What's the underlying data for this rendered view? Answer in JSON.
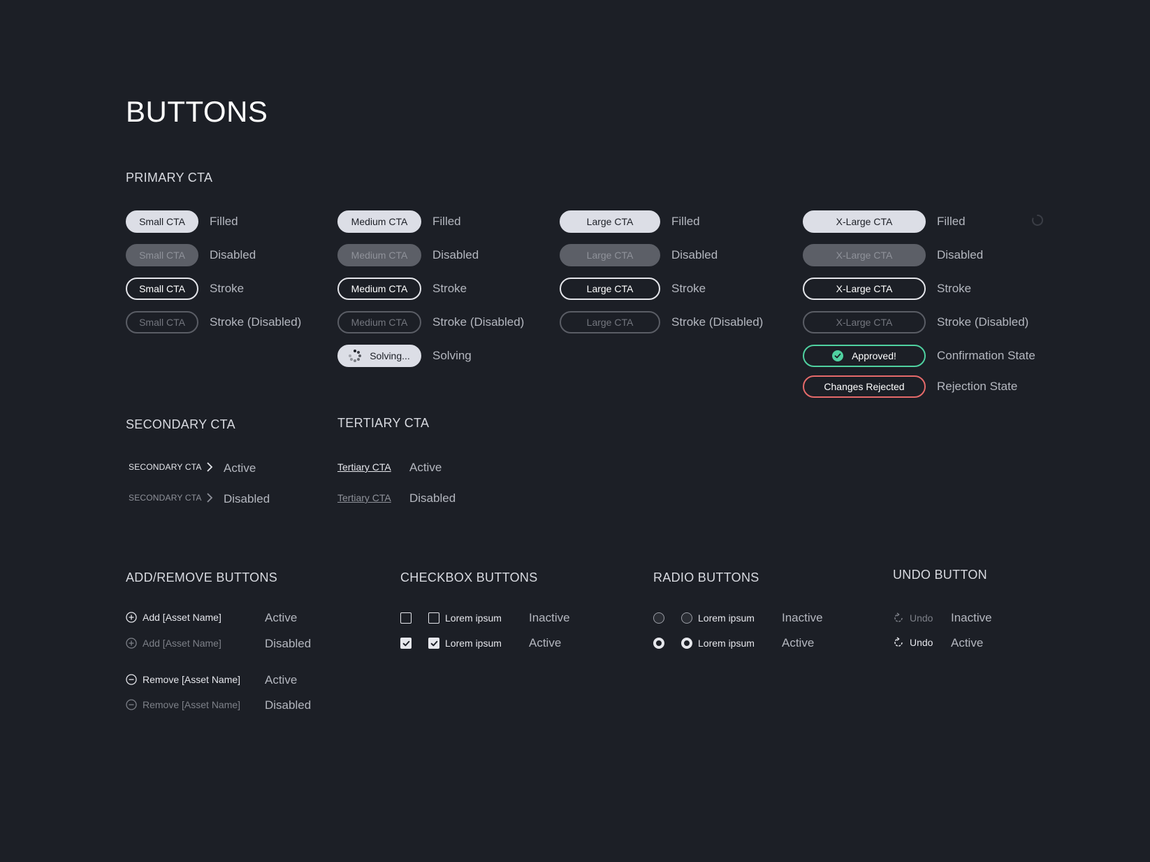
{
  "page": {
    "title": "BUTTONS"
  },
  "primary": {
    "title": "PRIMARY CTA",
    "labels": {
      "filled": "Filled",
      "disabled": "Disabled",
      "stroke": "Stroke",
      "stroke_disabled": "Stroke (Disabled)",
      "solving": "Solving",
      "confirmation": "Confirmation State",
      "rejection": "Rejection State"
    },
    "small": "Small CTA",
    "medium": "Medium CTA",
    "large": "Large CTA",
    "xlarge": "X-Large CTA",
    "solving_btn": "Solving...",
    "approved_btn": "Approved!",
    "rejected_btn": "Changes Rejected"
  },
  "secondary": {
    "title": "SECONDARY CTA",
    "button": "SECONDARY CTA",
    "active": "Active",
    "disabled": "Disabled"
  },
  "tertiary": {
    "title": "TERTIARY CTA",
    "button": "Tertiary CTA",
    "active": "Active",
    "disabled": "Disabled"
  },
  "addremove": {
    "title": "ADD/REMOVE BUTTONS",
    "add": "Add [Asset Name]",
    "remove": "Remove [Asset Name]",
    "active": "Active",
    "disabled": "Disabled"
  },
  "checkbox": {
    "title": "CHECKBOX BUTTONS",
    "label": "Lorem ipsum",
    "inactive": "Inactive",
    "active": "Active"
  },
  "radio": {
    "title": "RADIO BUTTONS",
    "label": "Lorem ipsum",
    "inactive": "Inactive",
    "active": "Active"
  },
  "undo": {
    "title": "UNDO BUTTON",
    "label": "Undo",
    "inactive": "Inactive",
    "active": "Active"
  },
  "colors": {
    "background": "#1c1f26",
    "filled": "#dcdee6",
    "disabled": "#5c5f67",
    "approved": "#4fd1a0",
    "rejected": "#e56a6a"
  }
}
